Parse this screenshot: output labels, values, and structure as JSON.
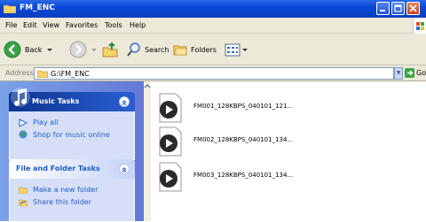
{
  "window": {
    "title": "FM_ENC"
  },
  "menu": [
    "File",
    "Edit",
    "View",
    "Favorites",
    "Tools",
    "Help"
  ],
  "toolbar": {
    "back_label": "Back",
    "search_label": "Search",
    "folders_label": "Folders"
  },
  "address": {
    "label": "Address",
    "value": "G:\\FM_ENC",
    "go_label": "Go"
  },
  "music_tasks": {
    "title": "Music Tasks",
    "items": [
      "Play all",
      "Shop for music online"
    ]
  },
  "file_tasks": {
    "title": "File and Folder Tasks",
    "items": [
      "Make a new folder",
      "Share this folder"
    ]
  },
  "files": [
    {
      "name": "FM001_128KBPS_040101_121..."
    },
    {
      "name": "FM002_128KBPS_040101_134..."
    },
    {
      "name": "FM003_128KBPS_040101_134..."
    }
  ]
}
